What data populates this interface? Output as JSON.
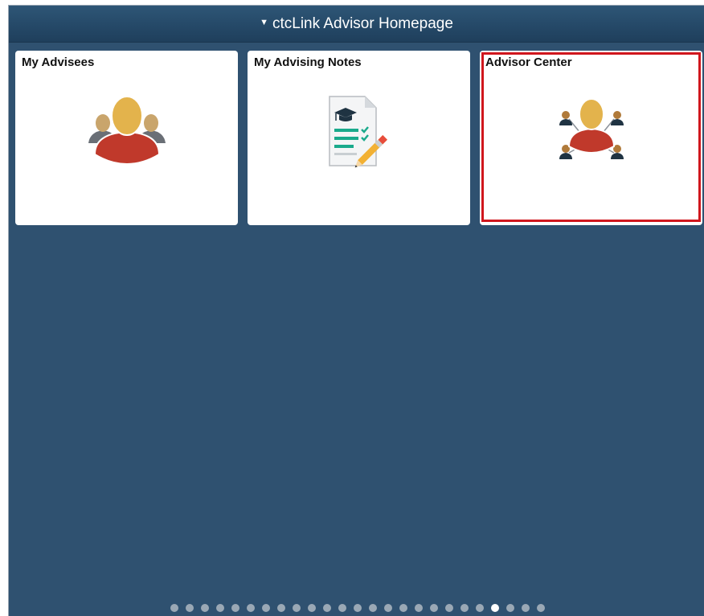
{
  "header": {
    "title": "ctcLink Advisor Homepage",
    "collapse_glyph": "▼"
  },
  "tiles": [
    {
      "title": "My Advisees",
      "icon": "advisees-icon"
    },
    {
      "title": "My Advising Notes",
      "icon": "advising-notes-icon"
    },
    {
      "title": "Advisor Center",
      "icon": "advisor-center-icon",
      "highlighted": true
    }
  ],
  "pagination": {
    "total_pages": 25,
    "active_page": 22
  },
  "colors": {
    "background": "#2f5170",
    "header": "#254968",
    "highlight": "#d0161d",
    "person_head": "#e3b34c",
    "person_body": "#c0392b",
    "notes_green": "#1aaa8c"
  }
}
